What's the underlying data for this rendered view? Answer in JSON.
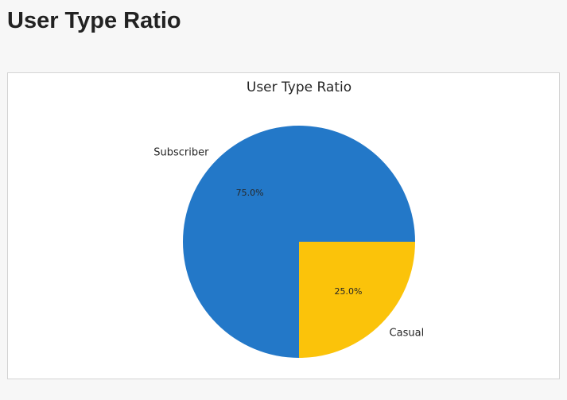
{
  "page": {
    "title": "User Type Ratio"
  },
  "chart_data": {
    "type": "pie",
    "title": "User Type Ratio",
    "categories": [
      "Subscriber",
      "Casual"
    ],
    "values": [
      75.0,
      25.0
    ],
    "percent_labels": [
      "75.0%",
      "25.0%"
    ],
    "colors": [
      "#2378c8",
      "#fbc30a"
    ],
    "start_angle": "0 (3 o'clock), clockwise order drawn counter-clockwise",
    "legend": "none"
  }
}
